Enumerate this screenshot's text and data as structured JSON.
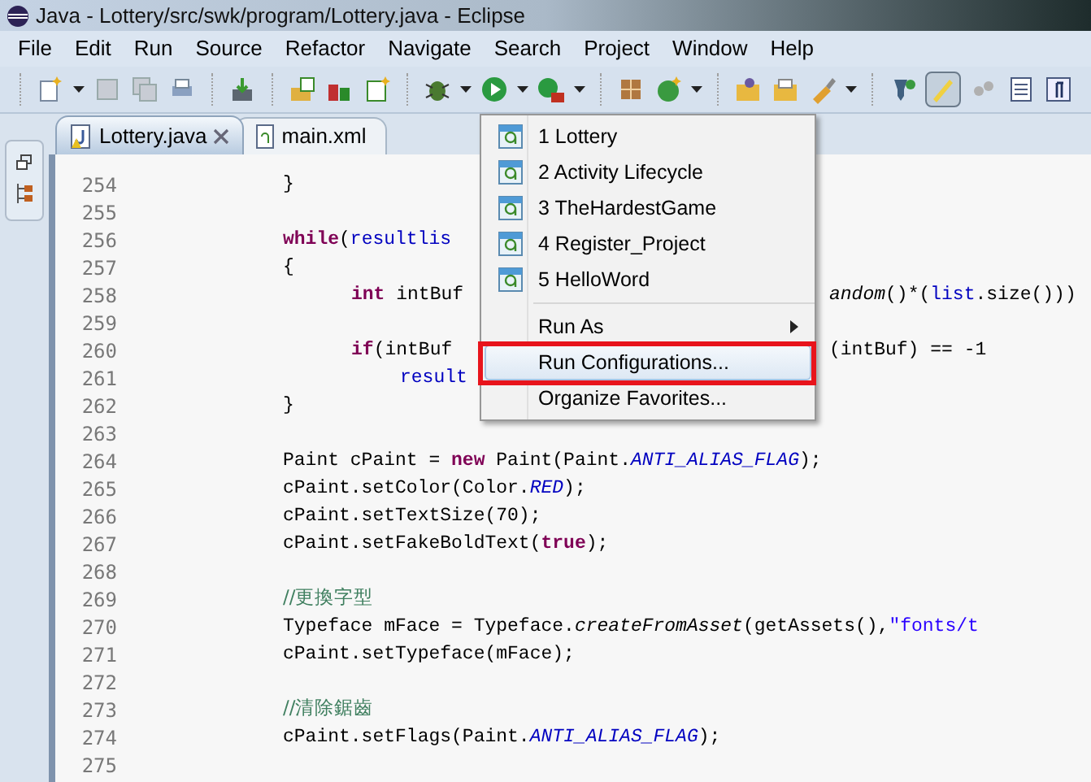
{
  "window": {
    "title": "Java - Lottery/src/swk/program/Lottery.java - Eclipse"
  },
  "menu_bar": [
    "File",
    "Edit",
    "Run",
    "Source",
    "Refactor",
    "Navigate",
    "Search",
    "Project",
    "Window",
    "Help"
  ],
  "tabs": [
    {
      "label": "Lottery.java",
      "selected": true,
      "kind": "java"
    },
    {
      "label": "main.xml",
      "selected": false,
      "kind": "xml"
    }
  ],
  "code_lines": [
    {
      "number": "254",
      "left": [
        {
          "text": "}",
          "kind": "plain"
        }
      ]
    },
    {
      "number": "255"
    },
    {
      "number": "256",
      "left": [
        {
          "text": "while",
          "kind": "keyword"
        },
        {
          "text": "(",
          "kind": "plain"
        },
        {
          "text": "resultlis",
          "kind": "variable"
        }
      ]
    },
    {
      "number": "257",
      "left": [
        {
          "text": "{",
          "kind": "plain"
        }
      ],
      "children": [
        {
          "number": "258",
          "left": [
            {
              "text": "int",
              "kind": "keyword"
            },
            {
              "text": " intBuf",
              "kind": "plain"
            }
          ],
          "right": [
            {
              "text": "andom",
              "kind": "static"
            },
            {
              "text": "()*(",
              "kind": "plain"
            },
            {
              "text": "list",
              "kind": "variable"
            },
            {
              "text": ".size()))",
              "kind": "plain"
            }
          ]
        },
        {
          "number": "259"
        },
        {
          "number": "260",
          "left": [
            {
              "text": "if",
              "kind": "keyword"
            },
            {
              "text": "(intBuf",
              "kind": "plain"
            }
          ],
          "right": [
            {
              "text": "(intBuf) == -1",
              "kind": "plain"
            }
          ],
          "children": [
            {
              "number": "261",
              "left": [
                {
                  "text": "result",
                  "kind": "variable"
                }
              ]
            }
          ]
        }
      ]
    },
    {
      "number": "262",
      "left": [
        {
          "text": "}",
          "kind": "plain"
        }
      ]
    },
    {
      "number": "263"
    },
    {
      "number": "264",
      "left": [
        {
          "text": "Paint cPaint = ",
          "kind": "plain"
        },
        {
          "text": "new",
          "kind": "keyword"
        },
        {
          "text": " Paint(Paint.",
          "kind": "plain"
        },
        {
          "text": "ANTI_ALIAS_FLAG",
          "kind": "field"
        },
        {
          "text": ");",
          "kind": "plain"
        }
      ]
    },
    {
      "number": "265",
      "left": [
        {
          "text": "cPaint.setColor(Color.",
          "kind": "plain"
        },
        {
          "text": "RED",
          "kind": "field"
        },
        {
          "text": ");",
          "kind": "plain"
        }
      ]
    },
    {
      "number": "266",
      "left": [
        {
          "text": "cPaint.setTextSize(70);",
          "kind": "plain"
        }
      ]
    },
    {
      "number": "267",
      "left": [
        {
          "text": "cPaint.setFakeBoldText(",
          "kind": "plain"
        },
        {
          "text": "true",
          "kind": "keyword"
        },
        {
          "text": ");",
          "kind": "plain"
        }
      ]
    },
    {
      "number": "268"
    },
    {
      "number": "269",
      "left": [
        {
          "text": "//更換字型",
          "kind": "comment"
        }
      ]
    },
    {
      "number": "270",
      "left": [
        {
          "text": "Typeface mFace = Typeface.",
          "kind": "plain"
        },
        {
          "text": "createFromAsset",
          "kind": "static"
        },
        {
          "text": "(getAssets(),",
          "kind": "plain"
        },
        {
          "text": "\"fonts/t",
          "kind": "string"
        }
      ]
    },
    {
      "number": "271",
      "left": [
        {
          "text": "cPaint.setTypeface(mFace);",
          "kind": "plain"
        }
      ]
    },
    {
      "number": "272"
    },
    {
      "number": "273",
      "left": [
        {
          "text": "//清除鋸齒",
          "kind": "comment"
        }
      ]
    },
    {
      "number": "274",
      "left": [
        {
          "text": "cPaint.setFlags(Paint.",
          "kind": "plain"
        },
        {
          "text": "ANTI_ALIAS_FLAG",
          "kind": "field"
        },
        {
          "text": ");",
          "kind": "plain"
        }
      ]
    },
    {
      "number": "275"
    }
  ],
  "run_menu": {
    "items": [
      {
        "kind": "launch",
        "label": "1 Lottery",
        "selected": false,
        "annotated": false
      },
      {
        "kind": "launch",
        "label": "2 Activity Lifecycle",
        "selected": false,
        "annotated": false
      },
      {
        "kind": "launch",
        "label": "3 TheHardestGame",
        "selected": false,
        "annotated": false
      },
      {
        "kind": "launch",
        "label": "4 Register_Project",
        "selected": false,
        "annotated": false
      },
      {
        "kind": "launch",
        "label": "5 HelloWord",
        "selected": false,
        "annotated": false
      },
      {
        "kind": "separator"
      },
      {
        "kind": "submenu",
        "label": "Run As",
        "selected": false,
        "annotated": false
      },
      {
        "kind": "action",
        "label": "Run Configurations...",
        "selected": true,
        "annotated": true
      },
      {
        "kind": "action",
        "label": "Organize Favorites...",
        "selected": false,
        "annotated": false
      }
    ]
  }
}
